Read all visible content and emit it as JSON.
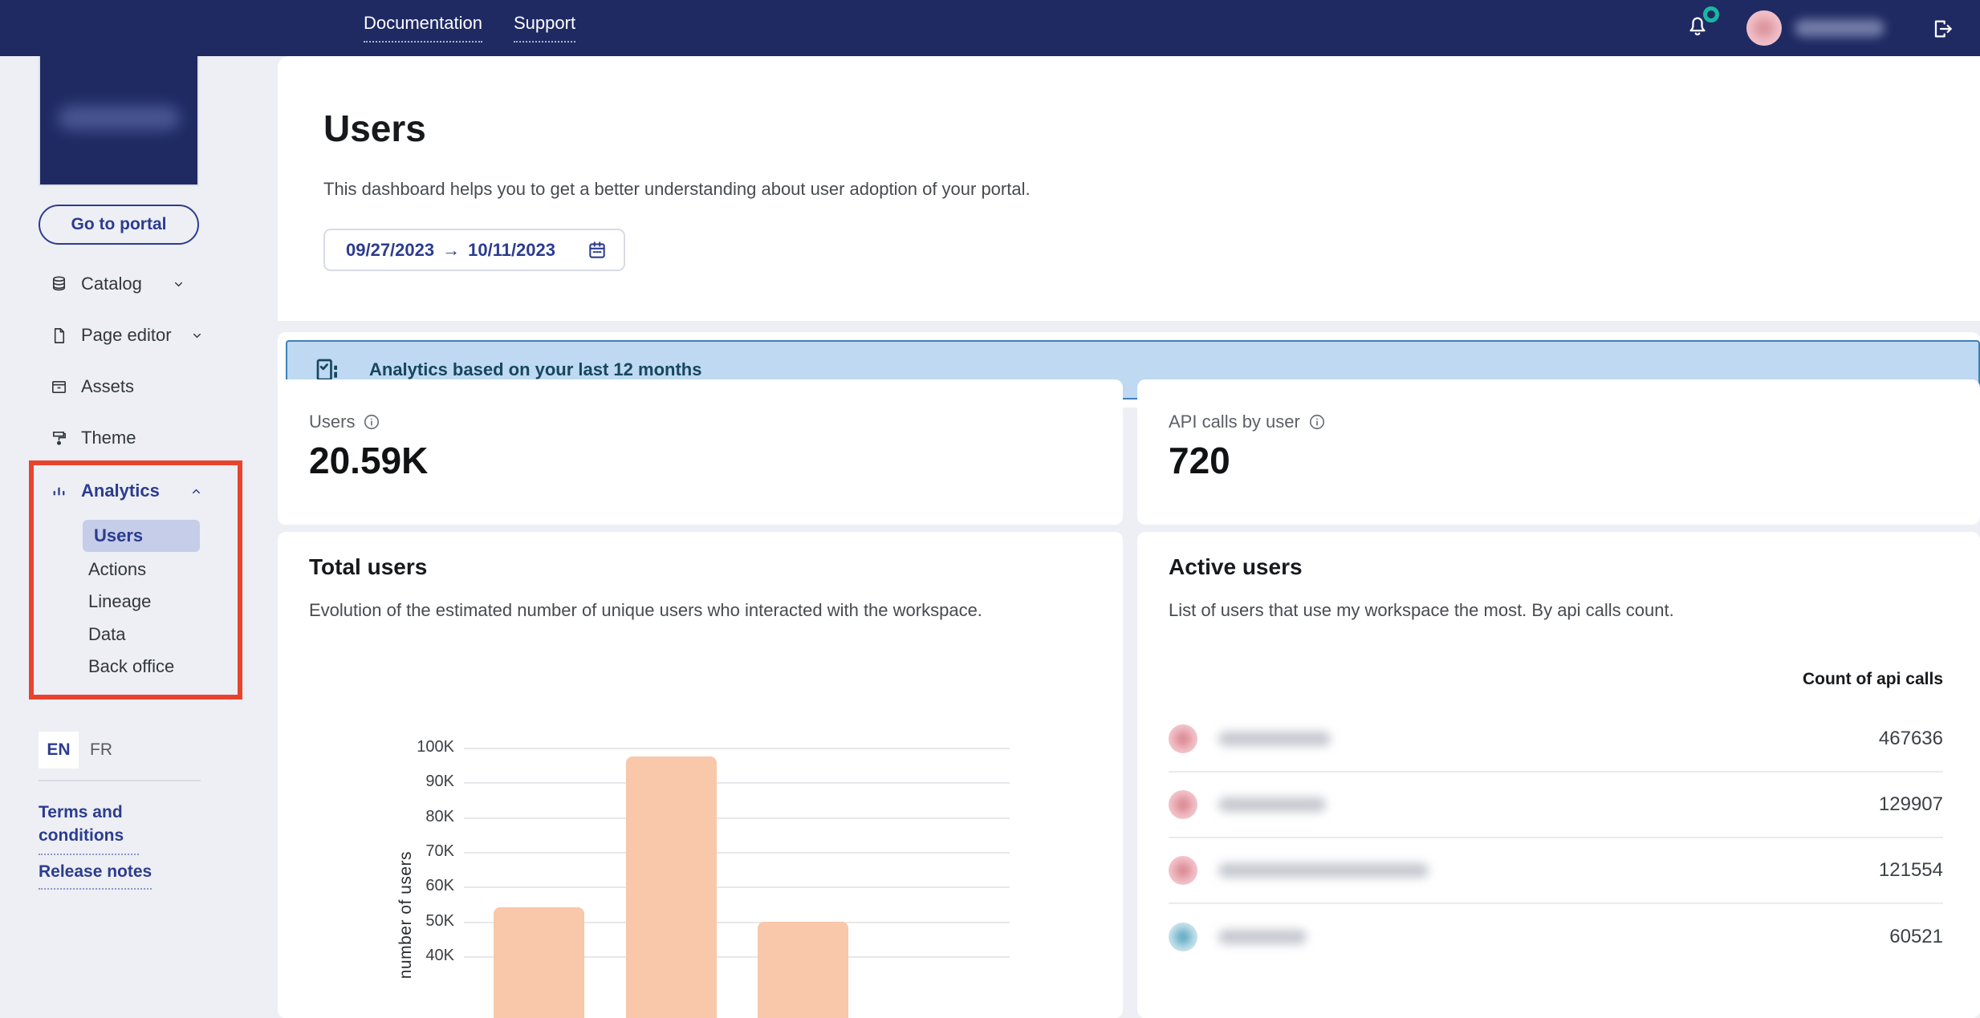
{
  "topbar": {
    "links": [
      {
        "label": "Documentation"
      },
      {
        "label": "Support"
      }
    ],
    "icons": {
      "bell": "notification-bell",
      "badge_color": "#17b8a2",
      "logout": "sign-out"
    }
  },
  "sidebar": {
    "portal_button": "Go to portal",
    "items": [
      {
        "label": "Catalog",
        "icon": "database-icon",
        "has_chevron": true
      },
      {
        "label": "Page editor",
        "icon": "page-icon",
        "has_chevron": true
      },
      {
        "label": "Assets",
        "icon": "archive-box-icon",
        "has_chevron": false
      },
      {
        "label": "Theme",
        "icon": "paint-format-icon",
        "has_chevron": false
      },
      {
        "label": "Analytics",
        "icon": "bar-chart-icon",
        "has_chevron": true,
        "active": true
      }
    ],
    "analytics_children": [
      {
        "label": "Users",
        "selected": true
      },
      {
        "label": "Actions"
      },
      {
        "label": "Lineage"
      },
      {
        "label": "Data"
      },
      {
        "label": "Back office"
      }
    ],
    "languages": {
      "selected": "EN",
      "other": "FR"
    },
    "links": [
      {
        "label": "Terms and conditions"
      },
      {
        "label": "Release notes"
      }
    ],
    "annotation_color": "#e8432d"
  },
  "main": {
    "title": "Users",
    "description": "This dashboard helps you to get a better understanding about user adoption of your portal.",
    "date_range": {
      "start": "09/27/2023",
      "arrow": "→",
      "end": "10/11/2023"
    },
    "banner": {
      "text": "Analytics based on your last 12 months",
      "bg": "#bed9f1",
      "border": "#3f80b6",
      "text_color": "#17465f"
    },
    "metrics": [
      {
        "label": "Users",
        "value": "20.59K"
      },
      {
        "label": "API calls by user",
        "value": "720"
      }
    ],
    "total_users_card": {
      "title": "Total users",
      "description": "Evolution of the estimated number of unique users who interacted with the workspace."
    },
    "active_users_card": {
      "title": "Active users",
      "description": "List of users that use my workspace the most. By api calls count.",
      "count_header": "Count of api calls",
      "rows": [
        {
          "value": "467636",
          "avatar_color": "pink"
        },
        {
          "value": "129907",
          "avatar_color": "pink"
        },
        {
          "value": "121554",
          "avatar_color": "pink"
        },
        {
          "value": "60521",
          "avatar_color": "teal"
        }
      ]
    }
  },
  "chart_data": {
    "type": "bar",
    "title": "Total users",
    "ylabel": "number of users",
    "values": [
      54000,
      97500,
      49800
    ],
    "y_ticks": [
      {
        "label": "100K",
        "value": 100000
      },
      {
        "label": "90K",
        "value": 90000
      },
      {
        "label": "80K",
        "value": 80000
      },
      {
        "label": "70K",
        "value": 70000
      },
      {
        "label": "60K",
        "value": 60000
      },
      {
        "label": "50K",
        "value": 50000
      },
      {
        "label": "40K",
        "value": 40000
      }
    ],
    "ylim_visible": [
      40000,
      100000
    ],
    "grid": true,
    "bar_color": "#f9c7a9",
    "note": "x-axis category labels are cut off below the screenshot fold"
  },
  "colors": {
    "topbar_navy": "#1f2a63",
    "page_bg": "#edeff4",
    "accent_navy": "#2c3c8f",
    "subitem_highlight": "#c5cde9",
    "annotation_red": "#e8432d",
    "badge_teal": "#17b8a2",
    "avatar_pink": "#f3c3cd",
    "avatar_teal": "#cfe7ee"
  }
}
